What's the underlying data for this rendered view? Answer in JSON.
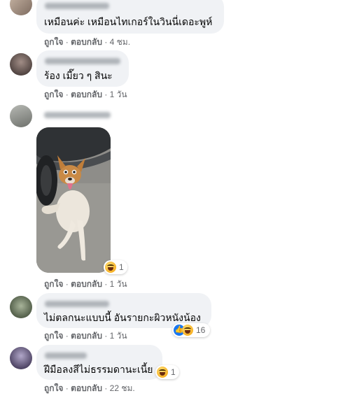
{
  "actions": {
    "like": "ถูกใจ",
    "reply": "ตอบกลับ",
    "sep": "·"
  },
  "comments": [
    {
      "text": "เหมือนค่ะ เหมือนไทเกอร์ในวินนี่เดอะพูห์",
      "time": "4 ชม."
    },
    {
      "text": "ร้อง เมี๊ยว ๆ สินะ",
      "time": "1 วัน"
    },
    {
      "photo": "dog-photo",
      "reaction_count": "1",
      "time": "1 วัน"
    },
    {
      "text": "ไม่ตลกนะแบบนี้ อันรายกะผิวหนังน้อง",
      "reaction_count": "16",
      "time": "1 วัน"
    },
    {
      "text": "ฝีมือลงสีไม่ธรรมดานะเนี้ย",
      "reaction_count": "1",
      "time": "22 ชม."
    }
  ],
  "colors": {
    "bubble": "#f0f2f5",
    "meta_text": "#65676b",
    "like_blue": "#1877f2",
    "haha_yellow": "#f7b125"
  },
  "icons": {
    "haha": "haha-reaction-icon",
    "like": "like-reaction-icon"
  }
}
